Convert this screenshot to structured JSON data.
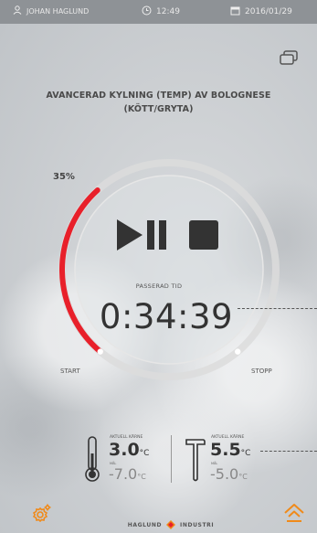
{
  "statusbar": {
    "user": "JOHAN HAGLUND",
    "time": "12:49",
    "date": "2016/01/29"
  },
  "program_title": "AVANCERAD KYLNING (TEMP) AV BOLOGNESE\n(KÖTT/GRYTA)",
  "progress": {
    "percent_label": "35%",
    "value": 0.35,
    "start_label": "START",
    "stop_label": "STOPP"
  },
  "elapsed": {
    "label": "PASSERAD TID",
    "value": "0:34:39"
  },
  "sensors": {
    "core": {
      "label": "AKTUELL KÄRNE",
      "value": "3.0",
      "unit": "°C",
      "target_label": "MÅL",
      "target": "-7.0",
      "target_unit": "°C"
    },
    "probe": {
      "label": "AKTUELL KÄRNE",
      "value": "5.5",
      "unit": "°C",
      "target_label": "MÅL",
      "target": "-5.0",
      "target_unit": "°C"
    }
  },
  "footer": {
    "brand_left": "HAGLUND",
    "brand_right": "INDUSTRI"
  },
  "colors": {
    "accent": "#e8202a",
    "warning": "#f08a1a",
    "ring": "#d8d8d8"
  },
  "icons": {
    "user": "user-icon",
    "clock": "clock-icon",
    "calendar": "calendar-icon",
    "window": "window-icon",
    "settings": "settings-icon",
    "home": "home-icon"
  }
}
